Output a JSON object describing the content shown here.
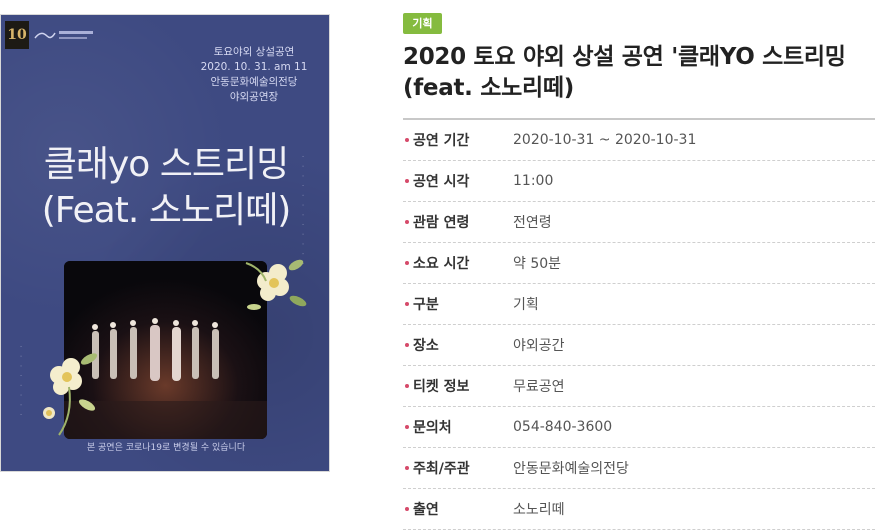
{
  "poster": {
    "logo_text": "10",
    "info_lines": [
      "토요야외 상설공연",
      "2020. 10. 31. am 11",
      "안동문화예술의전당",
      "야외공연장"
    ],
    "title_line1": "클래yo 스트리밍",
    "title_line2": "(Feat. 소노리떼)",
    "caption": "본 공연은 코로나19로 변경될 수 있습니다"
  },
  "event": {
    "category_tag": "기획",
    "title": "2020 토요 야외 상설 공연 '클래YO 스트리밍 (feat. 소노리떼)",
    "details": [
      {
        "label": "공연 기간",
        "value": "2020-10-31 ~ 2020-10-31"
      },
      {
        "label": "공연 시각",
        "value": "11:00"
      },
      {
        "label": "관람 연령",
        "value": "전연령"
      },
      {
        "label": "소요 시간",
        "value": "약 50분"
      },
      {
        "label": "구분",
        "value": "기획"
      },
      {
        "label": "장소",
        "value": "야외공간"
      },
      {
        "label": "티켓 정보",
        "value": "무료공연"
      },
      {
        "label": "문의처",
        "value": "054-840-3600"
      },
      {
        "label": "주최/주관",
        "value": "안동문화예술의전당"
      },
      {
        "label": "출연",
        "value": "소노리떼"
      }
    ]
  },
  "colors": {
    "tag_bg": "#85bb3f",
    "bullet": "#d64a6a",
    "poster_bg": "#3e4a82"
  }
}
